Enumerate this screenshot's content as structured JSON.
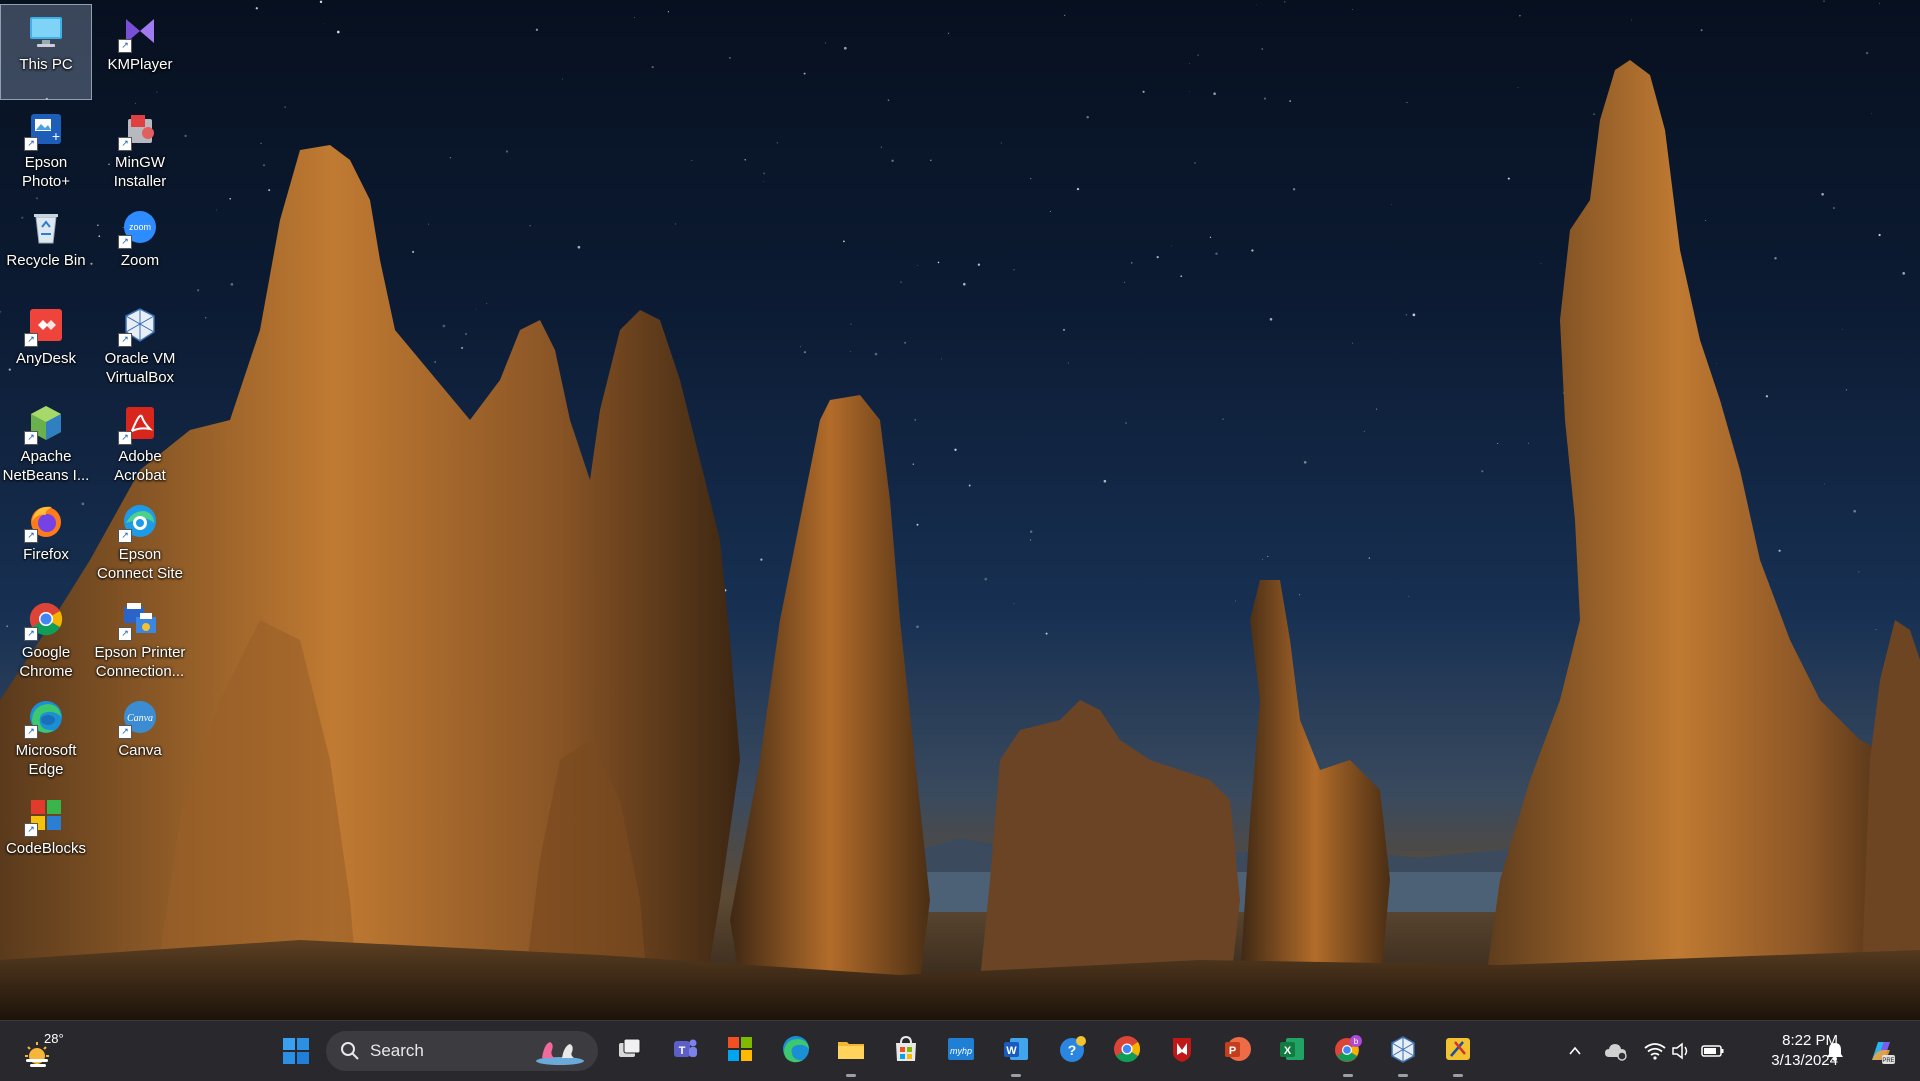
{
  "desktop": {
    "icons": [
      {
        "id": "this-pc",
        "label": "This PC",
        "icon": "this-pc-icon",
        "selected": true
      },
      {
        "id": "kmplayer",
        "label": "KMPlayer",
        "icon": "kmplayer-icon"
      },
      {
        "id": "epson-photo",
        "label": "Epson Photo+",
        "icon": "epson-photo-icon"
      },
      {
        "id": "mingw",
        "label": "MinGW Installer",
        "icon": "mingw-installer-icon"
      },
      {
        "id": "recycle-bin",
        "label": "Recycle Bin",
        "icon": "recycle-bin-icon"
      },
      {
        "id": "zoom",
        "label": "Zoom",
        "icon": "zoom-icon",
        "glyph": "zoom"
      },
      {
        "id": "anydesk",
        "label": "AnyDesk",
        "icon": "anydesk-icon"
      },
      {
        "id": "virtualbox",
        "label": "Oracle VM VirtualBox",
        "icon": "virtualbox-icon"
      },
      {
        "id": "netbeans",
        "label": "Apache NetBeans I...",
        "icon": "netbeans-icon"
      },
      {
        "id": "acrobat",
        "label": "Adobe Acrobat",
        "icon": "adobe-acrobat-icon"
      },
      {
        "id": "firefox",
        "label": "Firefox",
        "icon": "firefox-icon"
      },
      {
        "id": "epson-connect",
        "label": "Epson Connect Site",
        "icon": "epson-connect-icon"
      },
      {
        "id": "chrome",
        "label": "Google Chrome",
        "icon": "chrome-icon"
      },
      {
        "id": "epson-printer",
        "label": "Epson Printer Connection...",
        "icon": "epson-printer-icon"
      },
      {
        "id": "edge",
        "label": "Microsoft Edge",
        "icon": "edge-icon"
      },
      {
        "id": "canva",
        "label": "Canva",
        "icon": "canva-icon",
        "glyph": "Canva"
      },
      {
        "id": "codeblocks",
        "label": "CodeBlocks",
        "icon": "codeblocks-icon"
      }
    ]
  },
  "taskbar": {
    "weather": {
      "temp": "28°",
      "icon": "weather-sun-icon"
    },
    "search": {
      "placeholder": "Search",
      "icon": "search-icon"
    },
    "pinned": [
      {
        "id": "start",
        "icon": "windows-start-icon"
      },
      {
        "id": "task-view",
        "icon": "task-view-icon"
      },
      {
        "id": "teams",
        "icon": "teams-icon"
      },
      {
        "id": "microsoft-365",
        "icon": "microsoft-tiles-icon"
      },
      {
        "id": "edge",
        "icon": "edge-icon"
      },
      {
        "id": "file-explorer",
        "icon": "file-explorer-icon",
        "running": true
      },
      {
        "id": "store",
        "icon": "microsoft-store-icon"
      },
      {
        "id": "myhp",
        "icon": "myhp-icon",
        "glyph": "myhp"
      },
      {
        "id": "word",
        "icon": "word-icon",
        "glyph": "W",
        "running": true
      },
      {
        "id": "help",
        "icon": "get-help-icon"
      },
      {
        "id": "chrome",
        "icon": "chrome-icon"
      },
      {
        "id": "mcafee",
        "icon": "mcafee-icon"
      },
      {
        "id": "powerpoint",
        "icon": "powerpoint-icon",
        "glyph": "P"
      },
      {
        "id": "excel",
        "icon": "excel-icon",
        "glyph": "X"
      },
      {
        "id": "chrome-profile",
        "icon": "chrome-profile-icon",
        "glyph": "b",
        "running": true
      },
      {
        "id": "virtualbox",
        "icon": "virtualbox-icon",
        "running": true
      },
      {
        "id": "snipping-tool",
        "icon": "snipping-tool-icon",
        "running": true
      }
    ],
    "tray": {
      "chevron": "chevron-up-icon",
      "onedrive": "onedrive-icon",
      "wifi": "wifi-icon",
      "volume": "volume-icon",
      "battery": "battery-icon",
      "notification": "notification-bell-icon",
      "copilot": "copilot-icon",
      "time": "8:22 PM",
      "date": "3/13/2024"
    }
  },
  "colors": {
    "taskbar_bg": "#202024",
    "selection": "#b4c8e6",
    "windows_blue": "#0078d4"
  }
}
